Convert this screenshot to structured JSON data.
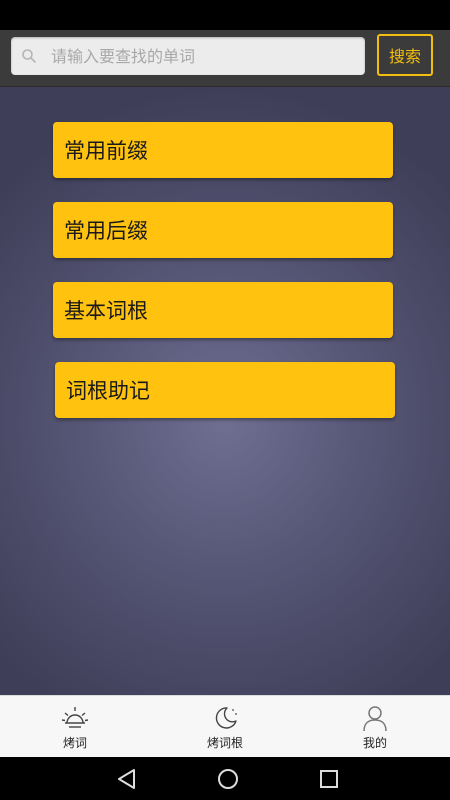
{
  "search": {
    "placeholder": "请输入要查找的单词",
    "button_label": "搜索"
  },
  "menu": {
    "items": [
      {
        "label": "常用前缀"
      },
      {
        "label": "常用后缀"
      },
      {
        "label": "基本词根"
      },
      {
        "label": "词根助记"
      }
    ]
  },
  "tabs": [
    {
      "label": "烤词",
      "icon": "sun-icon"
    },
    {
      "label": "烤词根",
      "icon": "moon-icon"
    },
    {
      "label": "我的",
      "icon": "user-icon"
    }
  ],
  "navigation": {
    "buttons": [
      "back-icon",
      "home-icon",
      "recents-icon"
    ]
  },
  "colors": {
    "accent": "#ffc20e",
    "header_bg": "#3b3b3b",
    "content_bg": "#565676",
    "tabbar_bg": "#f7f7f7"
  }
}
